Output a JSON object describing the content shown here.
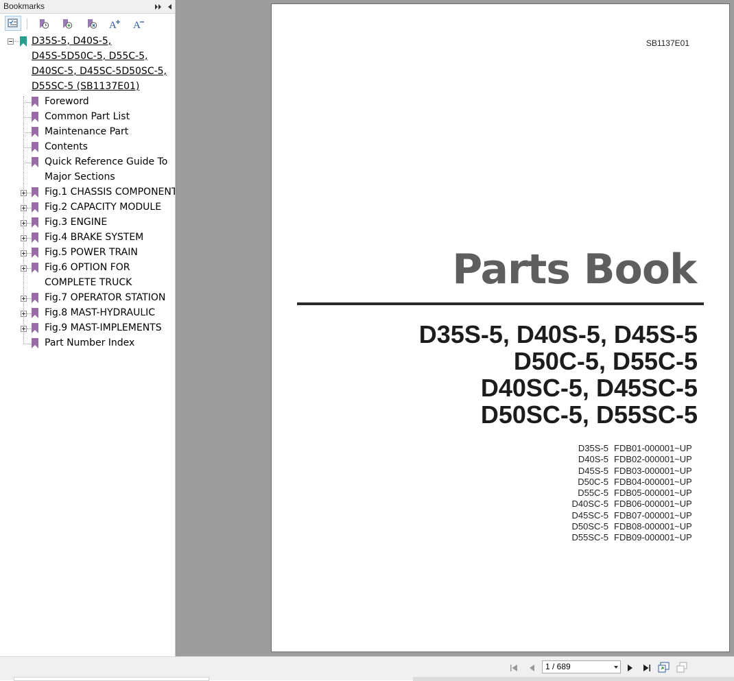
{
  "panel": {
    "title": "Bookmarks",
    "toolbar": [
      "bookmark-options-icon",
      "expand-bookmark-icon",
      "add-bookmark-icon",
      "delete-bookmark-icon",
      "increase-text-size-icon",
      "decrease-text-size-icon"
    ],
    "tree": {
      "root": {
        "lines": [
          "D35S-5, D40S-5,",
          "D45S-5D50C-5, D55C-5,",
          "D40SC-5, D45SC-5D50SC-5,",
          "D55SC-5 (SB1137E01)"
        ],
        "expanded": true
      },
      "items": [
        {
          "lines": [
            "Foreword"
          ],
          "expandable": false
        },
        {
          "lines": [
            "Common Part List"
          ],
          "expandable": false
        },
        {
          "lines": [
            "Maintenance Part"
          ],
          "expandable": false
        },
        {
          "lines": [
            "Contents"
          ],
          "expandable": false
        },
        {
          "lines": [
            "Quick Reference Guide To",
            "Major Sections"
          ],
          "expandable": false
        },
        {
          "lines": [
            "Fig.1 CHASSIS COMPONENT"
          ],
          "expandable": true
        },
        {
          "lines": [
            "Fig.2 CAPACITY MODULE"
          ],
          "expandable": true
        },
        {
          "lines": [
            "Fig.3 ENGINE"
          ],
          "expandable": true
        },
        {
          "lines": [
            "Fig.4 BRAKE SYSTEM"
          ],
          "expandable": true
        },
        {
          "lines": [
            "Fig.5 POWER TRAIN"
          ],
          "expandable": true
        },
        {
          "lines": [
            "Fig.6 OPTION FOR",
            "COMPLETE TRUCK"
          ],
          "expandable": true
        },
        {
          "lines": [
            "Fig.7 OPERATOR STATION"
          ],
          "expandable": true
        },
        {
          "lines": [
            "Fig.8 MAST-HYDRAULIC"
          ],
          "expandable": true
        },
        {
          "lines": [
            "Fig.9 MAST-IMPLEMENTS"
          ],
          "expandable": true
        },
        {
          "lines": [
            "Part Number Index"
          ],
          "expandable": false
        }
      ]
    }
  },
  "document": {
    "code": "SB1137E01",
    "title": "Parts Book",
    "models": [
      "D35S-5, D40S-5, D45S-5",
      "D50C-5, D55C-5",
      "D40SC-5, D45SC-5",
      "D50SC-5, D55SC-5"
    ],
    "serials": [
      {
        "model": "D35S-5",
        "serial": "FDB01-000001~UP"
      },
      {
        "model": "D40S-5",
        "serial": "FDB02-000001~UP"
      },
      {
        "model": "D45S-5",
        "serial": "FDB03-000001~UP"
      },
      {
        "model": "D50C-5",
        "serial": "FDB04-000001~UP"
      },
      {
        "model": "D55C-5",
        "serial": "FDB05-000001~UP"
      },
      {
        "model": "D40SC-5",
        "serial": "FDB06-000001~UP"
      },
      {
        "model": "D45SC-5",
        "serial": "FDB07-000001~UP"
      },
      {
        "model": "D50SC-5",
        "serial": "FDB08-000001~UP"
      },
      {
        "model": "D55SC-5",
        "serial": "FDB09-000001~UP"
      }
    ]
  },
  "navigation": {
    "page_display": "1 / 689",
    "current_page": 1,
    "total_pages": 689
  },
  "colors": {
    "bookmark_root": "#2a9d8f",
    "bookmark_item": "#9b6aa8",
    "viewer_background": "#9d9d9d",
    "title_gray": "#5e5e5e"
  }
}
